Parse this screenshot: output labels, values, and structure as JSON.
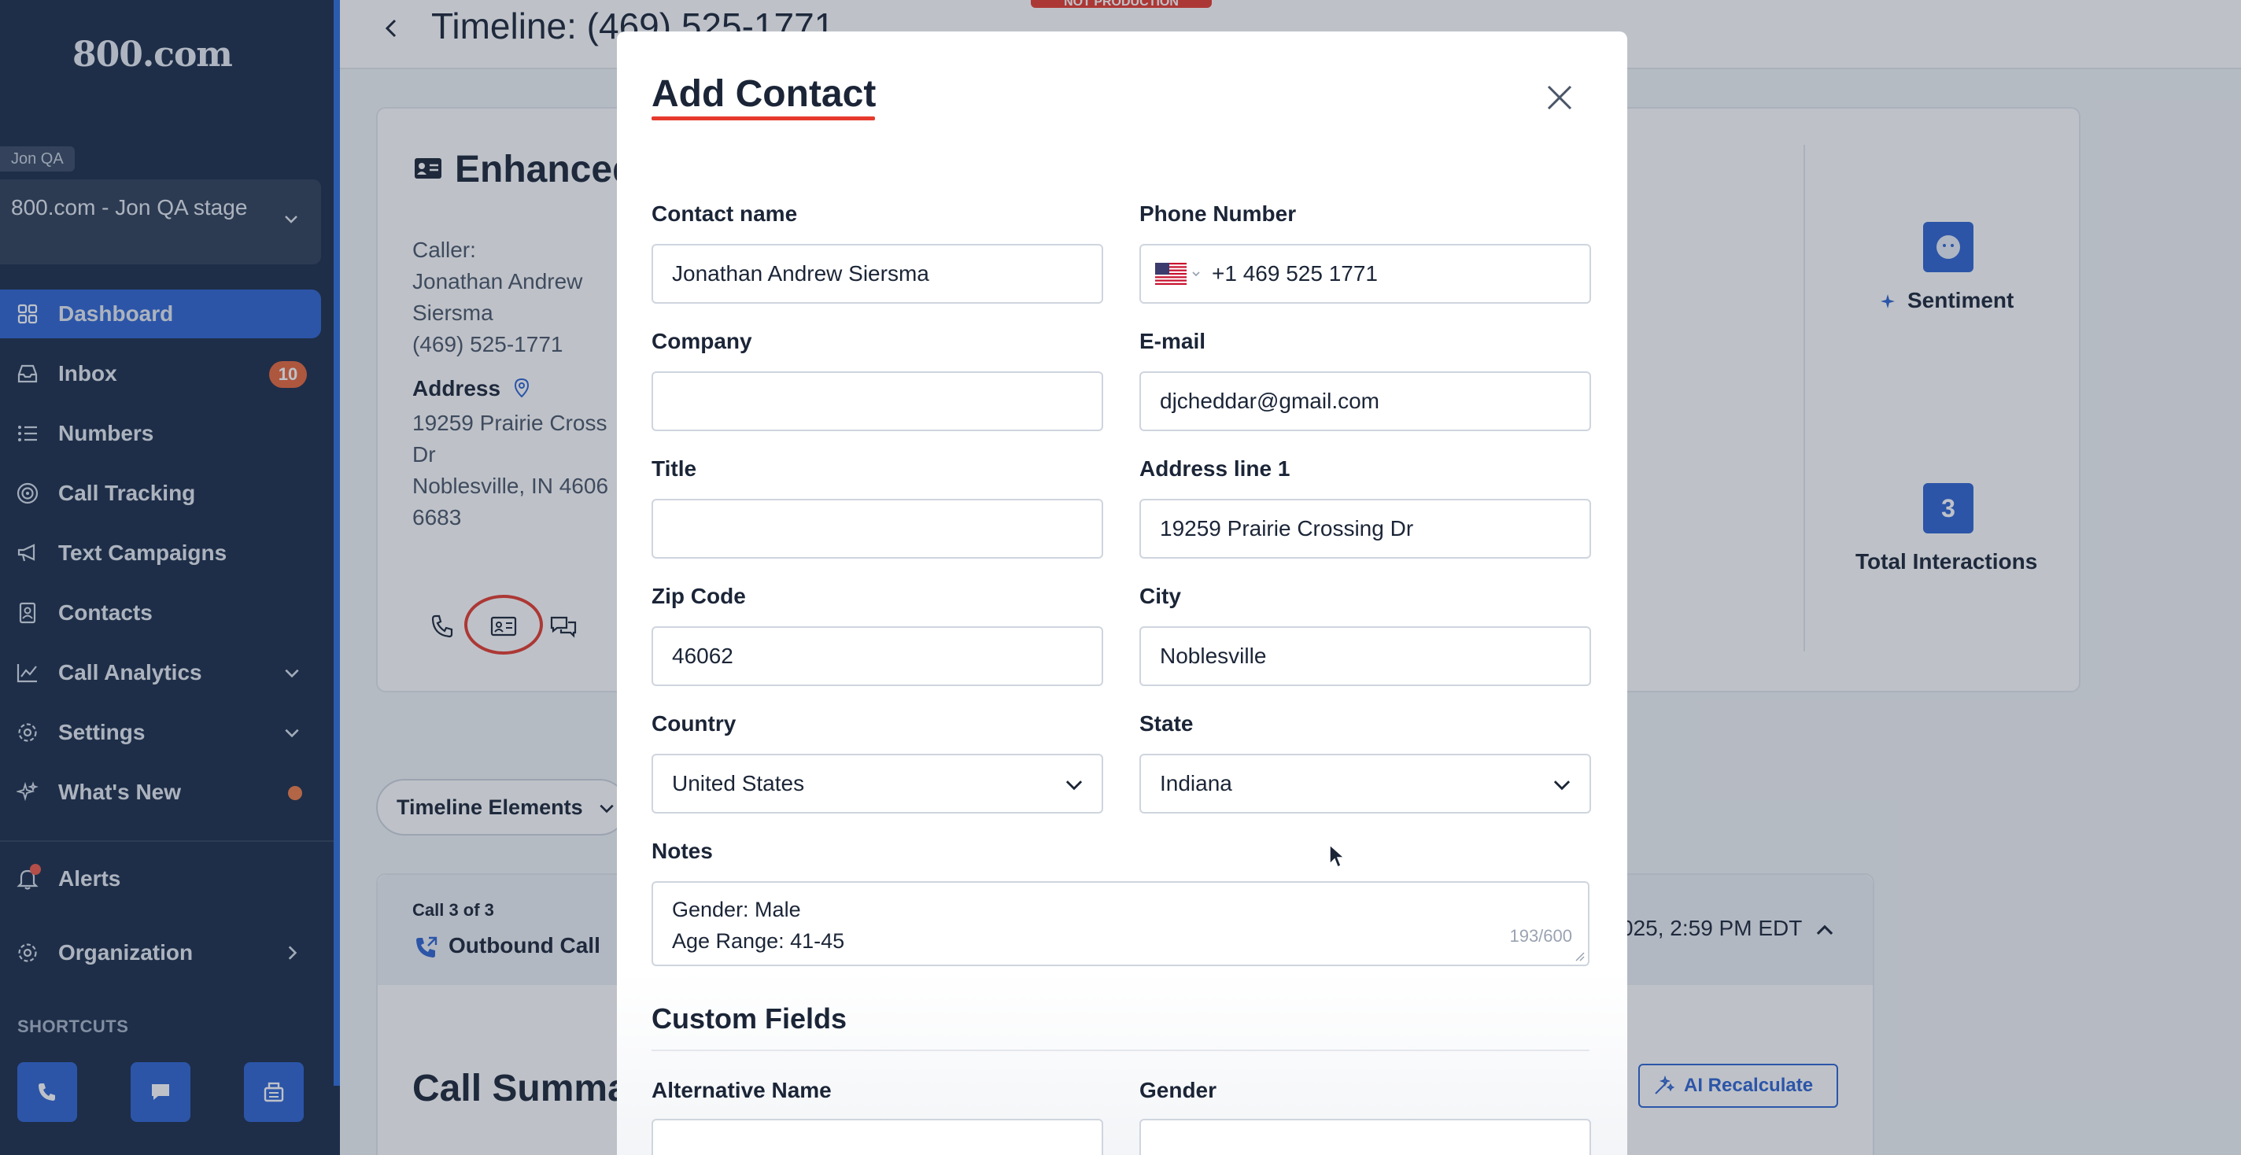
{
  "app": {
    "logo": "800.com",
    "page_title": "Timeline: (469) 525-1771",
    "env_badge": "NOT PRODUCTION"
  },
  "sidebar": {
    "org_tag": "Jon QA",
    "org_select": "800.com - Jon QA stage",
    "items": [
      {
        "label": "Dashboard",
        "icon": "grid-icon",
        "active": true
      },
      {
        "label": "Inbox",
        "icon": "inbox-icon",
        "badge": "10"
      },
      {
        "label": "Numbers",
        "icon": "list-icon"
      },
      {
        "label": "Call Tracking",
        "icon": "target-icon"
      },
      {
        "label": "Text Campaigns",
        "icon": "megaphone-icon"
      },
      {
        "label": "Contacts",
        "icon": "contact-book-icon"
      },
      {
        "label": "Call Analytics",
        "icon": "chart-line-icon"
      },
      {
        "label": "Settings",
        "icon": "gear-icon"
      },
      {
        "label": "What's New",
        "icon": "sparkle-icon"
      },
      {
        "label": "Alerts",
        "icon": "bell-icon"
      },
      {
        "label": "Organization",
        "icon": "gear-icon"
      }
    ],
    "shortcuts_label": "SHORTCUTS",
    "shortcuts": [
      "phone-icon",
      "chat-icon",
      "fax-icon"
    ]
  },
  "background": {
    "card_title": "Enhanced",
    "caller_label": "Caller:",
    "caller_lines": [
      "Jonathan Andrew",
      "Siersma",
      "(469) 525-1771"
    ],
    "address_label": "Address",
    "address_lines": [
      "19259 Prairie Cross",
      "Dr",
      "Noblesville, IN 4606",
      "6683"
    ],
    "sentiment_label": "Sentiment",
    "total_interactions_value": "3",
    "total_interactions_label": "Total Interactions",
    "timeline_elements": "Timeline Elements",
    "call_count": "Call 3 of 3",
    "call_type": "Outbound Call",
    "call_date": "025, 2:59 PM EDT",
    "call_summary": "Call Summa",
    "ai_recalculate": "AI Recalculate"
  },
  "modal": {
    "title": "Add Contact",
    "fields": {
      "contact_name": {
        "label": "Contact name",
        "value": "Jonathan Andrew Siersma"
      },
      "phone": {
        "label": "Phone Number",
        "value": "+1 469 525 1771"
      },
      "company": {
        "label": "Company",
        "value": ""
      },
      "email": {
        "label": "E-mail",
        "value": "djcheddar@gmail.com"
      },
      "title": {
        "label": "Title",
        "value": ""
      },
      "address1": {
        "label": "Address line 1",
        "value": "19259 Prairie Crossing Dr"
      },
      "zip": {
        "label": "Zip Code",
        "value": "46062"
      },
      "city": {
        "label": "City",
        "value": "Noblesville"
      },
      "country": {
        "label": "Country",
        "value": "United States"
      },
      "state": {
        "label": "State",
        "value": "Indiana"
      }
    },
    "notes": {
      "label": "Notes",
      "line1": "Gender: Male",
      "line2": "Age Range: 41-45",
      "counter": "193/600"
    },
    "custom_fields_title": "Custom Fields",
    "alt_name_label": "Alternative Name",
    "gender_label": "Gender"
  },
  "colors": {
    "sidebar": "#1a2b48",
    "accent": "#2e63d1",
    "danger": "#e53a2d",
    "badge": "#e8663b"
  }
}
